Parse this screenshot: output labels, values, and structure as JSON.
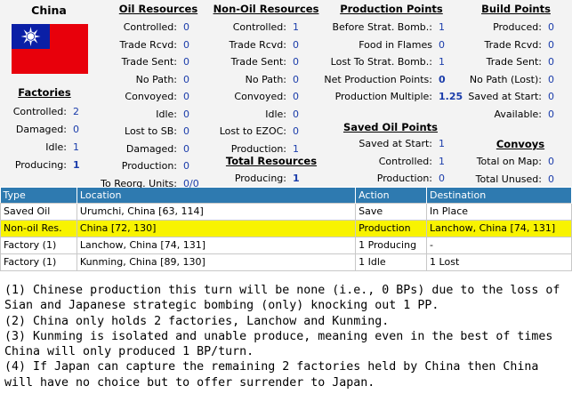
{
  "country": "China",
  "factories": {
    "title": "Factories",
    "rows": [
      {
        "label": "Controlled:",
        "value": "2"
      },
      {
        "label": "Damaged:",
        "value": "0"
      },
      {
        "label": "Idle:",
        "value": "1"
      },
      {
        "label": "Producing:",
        "value": "1"
      }
    ]
  },
  "oil": {
    "title": "Oil Resources",
    "rows": [
      {
        "label": "Controlled:",
        "value": "0"
      },
      {
        "label": "Trade Rcvd:",
        "value": "0"
      },
      {
        "label": "Trade Sent:",
        "value": "0"
      },
      {
        "label": "No Path:",
        "value": "0"
      },
      {
        "label": "Convoyed:",
        "value": "0"
      },
      {
        "label": "Idle:",
        "value": "0"
      },
      {
        "label": "Lost to SB:",
        "value": "0"
      },
      {
        "label": "Damaged:",
        "value": "0"
      },
      {
        "label": "Production:",
        "value": "0"
      },
      {
        "label": "To Reorg. Units:",
        "value": "0/0"
      }
    ]
  },
  "nonoil": {
    "title": "Non-Oil Resources",
    "rows": [
      {
        "label": "Controlled:",
        "value": "1"
      },
      {
        "label": "Trade Rcvd:",
        "value": "0"
      },
      {
        "label": "Trade Sent:",
        "value": "0"
      },
      {
        "label": "No Path:",
        "value": "0"
      },
      {
        "label": "Convoyed:",
        "value": "0"
      },
      {
        "label": "Idle:",
        "value": "0"
      },
      {
        "label": "Lost to EZOC:",
        "value": "0"
      },
      {
        "label": "Production:",
        "value": "1"
      }
    ]
  },
  "total": {
    "title": "Total Resources",
    "rows": [
      {
        "label": "Producing:",
        "value": "1"
      }
    ]
  },
  "production": {
    "title": "Production Points",
    "rows": [
      {
        "label": "Before Strat. Bomb.:",
        "value": "1"
      },
      {
        "label": "Food in Flames",
        "value": "0"
      },
      {
        "label": "Lost To Strat. Bomb.:",
        "value": "1"
      },
      {
        "label": "Net Production Points:",
        "value": "0"
      },
      {
        "label": "Production Multiple:",
        "value": "1.25"
      }
    ]
  },
  "saved": {
    "title": "Saved Oil Points",
    "rows": [
      {
        "label": "Saved at Start:",
        "value": "1"
      },
      {
        "label": "Controlled:",
        "value": "1"
      },
      {
        "label": "Production:",
        "value": "0"
      }
    ]
  },
  "build": {
    "title": "Build Points",
    "rows": [
      {
        "label": "Produced:",
        "value": "0"
      },
      {
        "label": "Trade Rcvd:",
        "value": "0"
      },
      {
        "label": "Trade Sent:",
        "value": "0"
      },
      {
        "label": "No Path (Lost):",
        "value": "0"
      },
      {
        "label": "Saved at Start:",
        "value": "0"
      },
      {
        "label": "Available:",
        "value": "0"
      }
    ]
  },
  "convoys": {
    "title": "Convoys",
    "rows": [
      {
        "label": "Total on Map:",
        "value": "0"
      },
      {
        "label": "Total Unused:",
        "value": "0"
      }
    ]
  },
  "table": {
    "headers": [
      "Type",
      "Location",
      "Action",
      "Destination"
    ],
    "rows": [
      [
        "Saved Oil",
        "Urumchi, China [63, 114]",
        "Save",
        "In Place"
      ],
      [
        "Non-oil Res.",
        "China [72, 130]",
        "Production",
        "Lanchow, China [74, 131]"
      ],
      [
        "Factory (1)",
        "Lanchow, China [74, 131]",
        "1 Producing",
        "-"
      ],
      [
        "Factory (1)",
        "Kunming, China [89, 130]",
        "1 Idle",
        "1 Lost"
      ]
    ],
    "highlight_color": "#f8f300",
    "header_color": "#2e7ab0"
  },
  "notes": [
    "(1) Chinese production this turn will be none (i.e., 0 BPs) due to the loss of Sian and Japanese strategic bombing (only) knocking out 1 PP.",
    "(2) China only holds 2 factories, Lanchow and Kunming.",
    "(3) Kunming is isolated and unable produce, meaning even in the best of times China will only produced 1 BP/turn.",
    "(4) If Japan can capture the remaining 2 factories held by China then China will have no choice but to offer surrender to Japan."
  ]
}
